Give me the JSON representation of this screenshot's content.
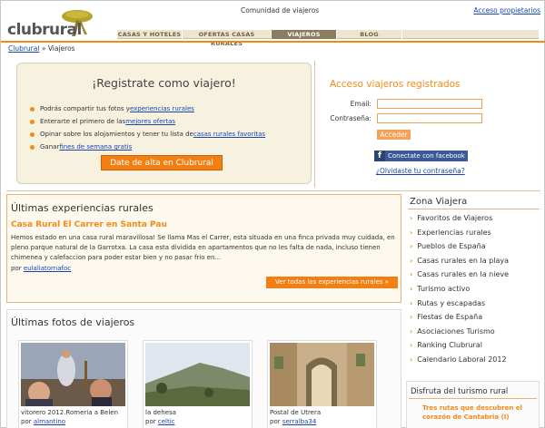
{
  "header": {
    "logo_text": "clubrural",
    "community_label": "Comunidad de viajeros",
    "owner_access_link": "Acceso propietarios",
    "nav": [
      {
        "label": "CASAS Y HOTELES",
        "active": false
      },
      {
        "label": "OFERTAS CASAS RURALES",
        "active": false
      },
      {
        "label": "VIAJEROS",
        "active": true
      },
      {
        "label": "BLOG",
        "active": false
      }
    ]
  },
  "breadcrumb": {
    "home": "Clubrural",
    "separator": "»",
    "current": "Viajeros"
  },
  "register": {
    "title": "¡Registrate como viajero!",
    "items": [
      {
        "prefix": "Podrás compartir tus fotos y ",
        "link": "experiencias rurales",
        "suffix": ""
      },
      {
        "prefix": "Enterarte el primero de las ",
        "link": "mejores ofertas",
        "suffix": ""
      },
      {
        "prefix": "Opinar sobre los alojamientos y tener tu lista de ",
        "link": "casas rurales favoritas",
        "suffix": ""
      },
      {
        "prefix": "Ganar ",
        "link": "fines de semana gratis",
        "suffix": ""
      }
    ],
    "button": "Date de alta en Clubrural"
  },
  "login": {
    "title": "Acceso viajeros registrados",
    "email_label": "Email:",
    "password_label": "Contraseña:",
    "email_value": "",
    "password_value": "",
    "submit": "Acceder",
    "facebook": "Conectate con facebook",
    "forgot": "¿Olvidaste tu contraseña?"
  },
  "experiences": {
    "title": "Últimas experiencias rurales",
    "item_title": "Casa Rural El Carrer en Santa Pau",
    "item_text": "Hemos estado en una casa rural maravillosa! Se llama Mas el Carrer, esta situada en una finca privada muy cuidada, en pleno parque natural de la Garrotxa. La casa esta dividida en apartamentos que no les falta de nada, incluso tienen chimenea y calefaccion para poder estar bien y no pasar frio en...",
    "by_prefix": "por ",
    "author": "eulaliatornafoc",
    "see_all": "Ver todas las experiencias rurales »"
  },
  "photos": {
    "title": "Últimas fotos de viajeros",
    "items": [
      {
        "caption": "vitorero 2012.Romeria a Belen",
        "by_prefix": "por ",
        "author": "almantino"
      },
      {
        "caption": "la dehesa",
        "by_prefix": "por ",
        "author": "celtic"
      },
      {
        "caption": "Postal de Utrera",
        "by_prefix": "por ",
        "author": "serralba34"
      }
    ]
  },
  "sidebar": {
    "title": "Zona Viajera",
    "items": [
      "Favoritos de Viajeros",
      "Experiencias rurales",
      "Pueblos de España",
      "Casas rurales en la playa",
      "Casas rurales en la nieve",
      "Turismo activo",
      "Rutas y escapadas",
      "Fiestas de España",
      "Asociaciones Turismo",
      "Ranking Clubrural",
      "Calendario Laboral 2012"
    ],
    "disfruta_title": "Disfruta del turismo rural",
    "disfruta_text": "Tres rutas que descubren el corazón de Cantabria (I)"
  },
  "colors": {
    "accent": "#f18a19",
    "nav_bg": "#ede5cf",
    "nav_active": "#8b7c5f",
    "link": "#1a44b0"
  }
}
